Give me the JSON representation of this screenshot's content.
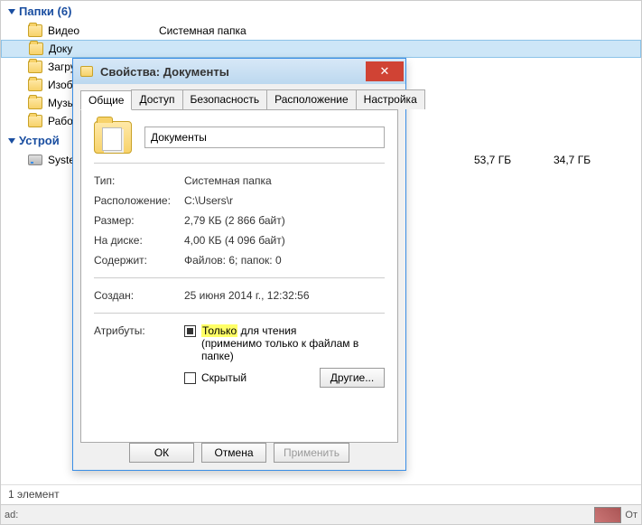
{
  "explorer": {
    "folders_header": "Папки (6)",
    "devices_header": "Устрой",
    "type_column_label": "Системная папка",
    "folders": [
      "Видео",
      "Доку",
      "Загру",
      "Изоб",
      "Музы",
      "Рабо"
    ],
    "drive_label": "Syste",
    "drive_size1": "53,7 ГБ",
    "drive_size2": "34,7 ГБ",
    "status": "1 элемент",
    "taskbar_left": "ad:",
    "taskbar_right": "От"
  },
  "dialog": {
    "title": "Свойства: Документы",
    "tabs": [
      "Общие",
      "Доступ",
      "Безопасность",
      "Расположение",
      "Настройка"
    ],
    "name_value": "Документы",
    "rows": {
      "type_label": "Тип:",
      "type_value": "Системная папка",
      "location_label": "Расположение:",
      "location_value": "C:\\Users\\r",
      "size_label": "Размер:",
      "size_value": "2,79 КБ (2 866 байт)",
      "ondisk_label": "На диске:",
      "ondisk_value": "4,00 КБ (4 096 байт)",
      "contains_label": "Содержит:",
      "contains_value": "Файлов: 6; папок: 0",
      "created_label": "Создан:",
      "created_value": "25 июня 2014 г., 12:32:56",
      "attributes_label": "Атрибуты:"
    },
    "readonly_label_hl": "Только",
    "readonly_label_rest": " для чтения",
    "readonly_note": "(применимо только к файлам в папке)",
    "hidden_label": "Скрытый",
    "other_button": "Другие...",
    "ok": "ОК",
    "cancel": "Отмена",
    "apply": "Применить"
  }
}
